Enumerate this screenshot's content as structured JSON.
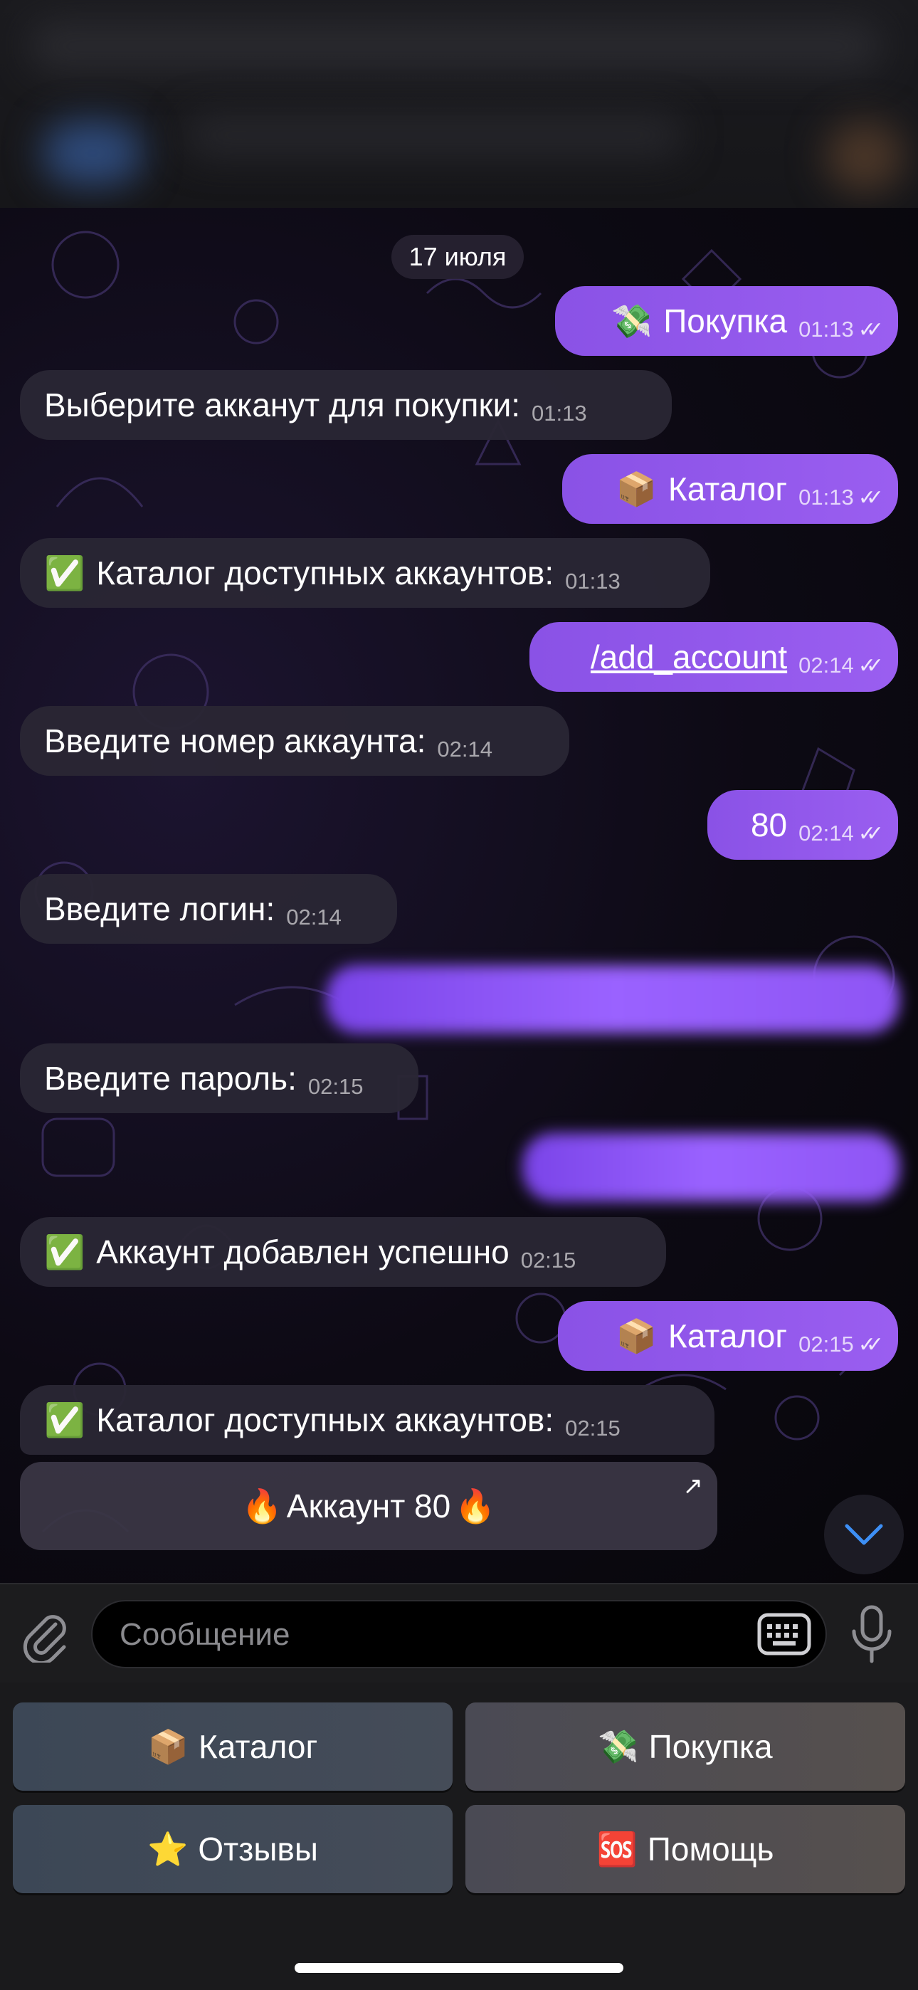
{
  "chat": {
    "date": "17 июля",
    "messages": [
      {
        "dir": "out",
        "emoji": "💸",
        "text": "Покупка",
        "time": "01:13"
      },
      {
        "dir": "in",
        "text": "Выберите акканут для покупки:",
        "time": "01:13"
      },
      {
        "dir": "out",
        "emoji": "📦",
        "text": "Каталог",
        "time": "01:13"
      },
      {
        "dir": "in",
        "emoji": "✅",
        "text": "Каталог доступных аккаунтов:",
        "time": "01:13"
      },
      {
        "dir": "out",
        "text": "/add_account",
        "time": "02:14"
      },
      {
        "dir": "in",
        "text": "Введите номер аккаунта:",
        "time": "02:14"
      },
      {
        "dir": "out",
        "text": "80",
        "time": "02:14"
      },
      {
        "dir": "in",
        "text": "Введите логин:",
        "time": "02:14"
      },
      {
        "dir": "in",
        "text": "Введите пароль:",
        "time": "02:15"
      },
      {
        "dir": "in",
        "emoji": "✅",
        "text": "Аккаунт добавлен успешно",
        "time": "02:15"
      },
      {
        "dir": "out",
        "emoji": "📦",
        "text": "Каталог",
        "time": "02:15"
      },
      {
        "dir": "in",
        "emoji": "✅",
        "text": "Каталог доступных аккаунтов:",
        "time": "02:15"
      }
    ],
    "read_ticks": "✓✓",
    "inline_button": {
      "emoji_left": "🔥",
      "label": "Аккаунт 80",
      "emoji_right": "🔥",
      "corner_icon": "↗"
    }
  },
  "input": {
    "placeholder": "Сообщение"
  },
  "reply_keyboard": [
    {
      "emoji": "📦",
      "label": "Каталог"
    },
    {
      "emoji": "💸",
      "label": "Покупка"
    },
    {
      "emoji": "⭐",
      "label": "Отзывы"
    },
    {
      "emoji": "🆘",
      "label": "Помощь"
    }
  ],
  "icons": {
    "attach": "paperclip-icon",
    "keyboard": "keyboard-icon",
    "mic": "microphone-icon",
    "scroll": "chevron-down-icon"
  },
  "colors": {
    "outgoing_bubble": "#9a5ef0",
    "incoming_bubble": "#2a2634",
    "background": "#000000"
  }
}
